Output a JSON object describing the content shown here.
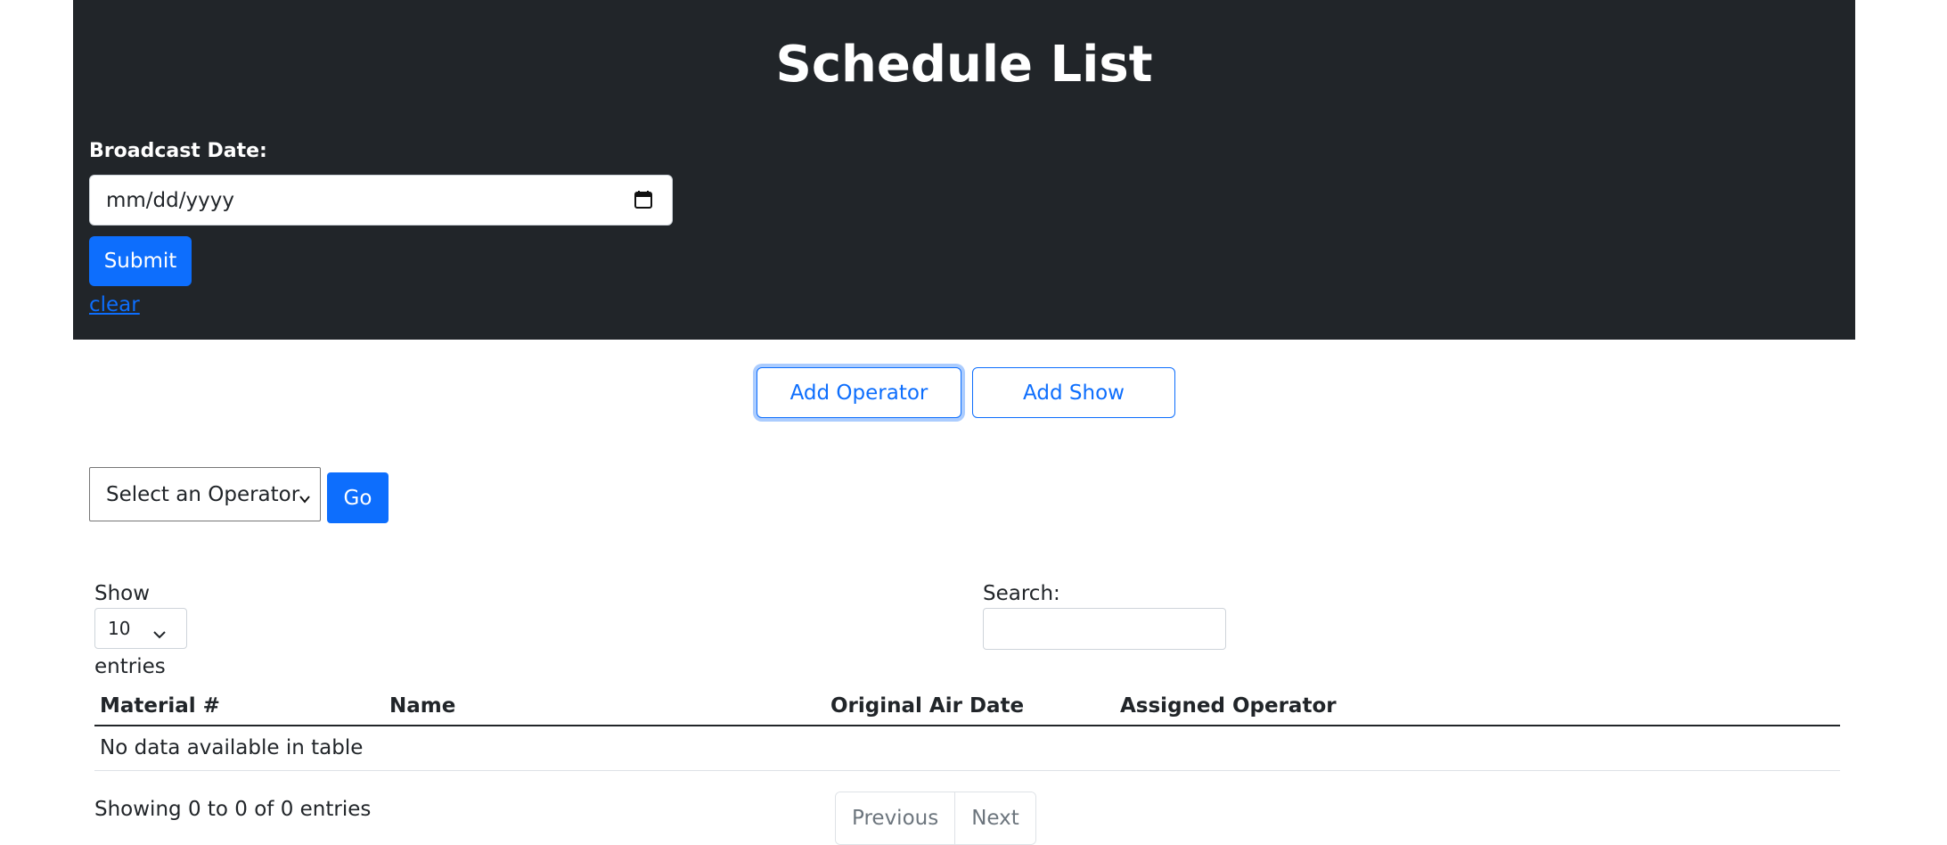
{
  "header": {
    "title": "Schedule List",
    "date_label": "Broadcast Date:",
    "date_placeholder": "mm/dd/yyyy",
    "submit_label": "Submit",
    "clear_label": "clear"
  },
  "actions": {
    "add_operator_label": "Add Operator",
    "add_show_label": "Add Show"
  },
  "operator_filter": {
    "selected": "Select an Operator",
    "go_label": "Go"
  },
  "table_controls": {
    "show_label": "Show",
    "length_value": "10",
    "entries_label": "entries",
    "search_label": "Search:",
    "search_value": ""
  },
  "table": {
    "columns": [
      "Material #",
      "Name",
      "Original Air Date",
      "Assigned Operator"
    ],
    "empty_message": "No data available in table"
  },
  "footer": {
    "info": "Showing 0 to 0 of 0 entries",
    "previous_label": "Previous",
    "next_label": "Next"
  },
  "colors": {
    "header_bg": "#212529",
    "primary": "#0d6efd",
    "muted": "#6c757d"
  },
  "icons": {
    "date_picker": "calendar-icon",
    "select_arrow": "chevron-down-icon"
  }
}
